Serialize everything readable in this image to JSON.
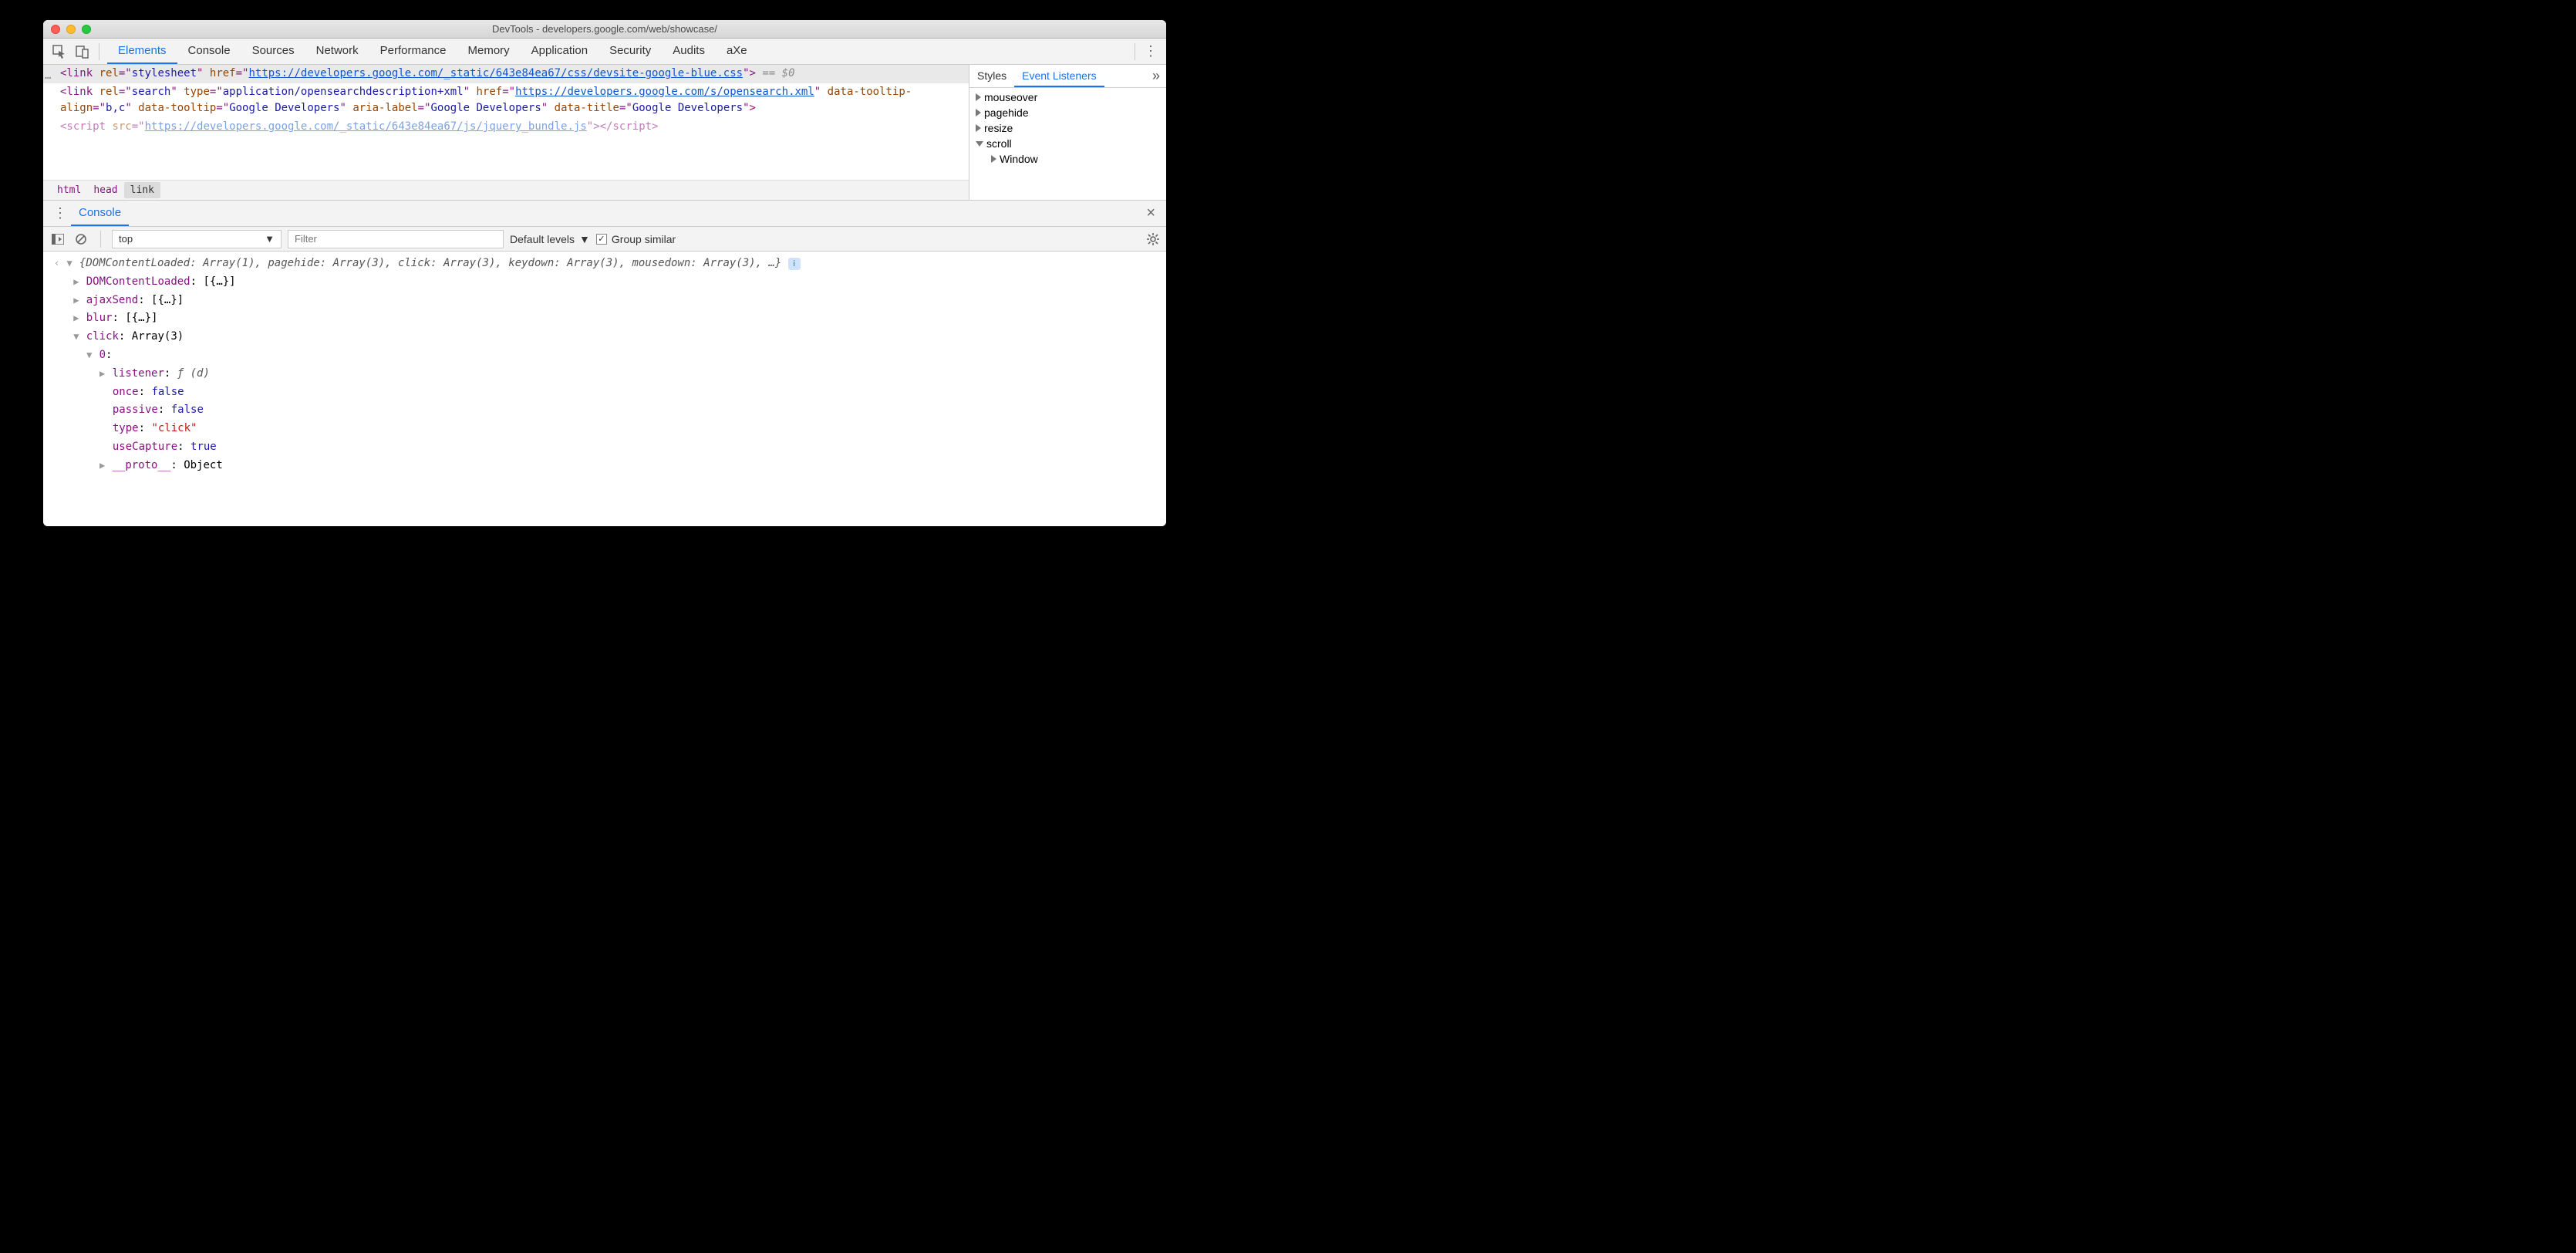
{
  "window": {
    "title": "DevTools - developers.google.com/web/showcase/"
  },
  "mainTabs": [
    "Elements",
    "Console",
    "Sources",
    "Network",
    "Performance",
    "Memory",
    "Application",
    "Security",
    "Audits",
    "aXe"
  ],
  "mainTabActive": "Elements",
  "dom": {
    "line1": {
      "prefix": "<link ",
      "rel_attr": "rel",
      "rel_val": "stylesheet",
      "href_attr": "href",
      "href_val": "https://developers.google.com/_static/643e84ea67/css/devsite-google-blue.css",
      "suffix": ">",
      "eqz": " == $0"
    },
    "line2": {
      "prefix": "<link ",
      "rel_attr": "rel",
      "rel_val": "search",
      "type_attr": "type",
      "type_val": "application/opensearchdescription+xml",
      "href_attr": "href",
      "href_val": "https://developers.google.com/s/opensearch.xml",
      "dta_attr": "data-tooltip-align",
      "dta_val": "b,c",
      "dt_attr": "data-tooltip",
      "dt_val": "Google Developers",
      "al_attr": "aria-label",
      "al_val": "Google Developers",
      "dtt_attr": "data-title",
      "dtt_val": "Google Developers",
      "suffix": ">"
    },
    "line3": {
      "open": "<script ",
      "src_attr": "src",
      "src_val": "https://developers.google.com/_static/643e84ea67/js/jquery_bundle.js",
      "mid": "></",
      "close": "script>"
    }
  },
  "breadcrumbs": {
    "a": "html",
    "b": "head",
    "c": "link"
  },
  "sidebar": {
    "tabs": {
      "styles": "Styles",
      "event": "Event Listeners"
    },
    "events": {
      "mouseover": "mouseover",
      "pagehide": "pagehide",
      "resize": "resize",
      "scroll": "scroll",
      "window": "Window"
    }
  },
  "drawer": {
    "tab": "Console"
  },
  "consoleToolbar": {
    "context": "top",
    "filterPlaceholder": "Filter",
    "levels": "Default levels",
    "groupSimilar": "Group similar"
  },
  "console": {
    "summary_open": "{",
    "summary_k1": "DOMContentLoaded",
    "summary_v1": "Array(1)",
    "summary_k2": "pagehide",
    "summary_v2": "Array(3)",
    "summary_k3": "click",
    "summary_v3": "Array(3)",
    "summary_k4": "keydown",
    "summary_v4": "Array(3)",
    "summary_k5": "mousedown",
    "summary_v5": "Array(3)",
    "summary_close": ", …}",
    "r1_k": "DOMContentLoaded",
    "r1_v": "[{…}]",
    "r2_k": "ajaxSend",
    "r2_v": "[{…}]",
    "r3_k": "blur",
    "r3_v": "[{…}]",
    "r4_k": "click",
    "r4_v": "Array(3)",
    "idx0": "0",
    "listener_k": "listener",
    "listener_v": "ƒ (d)",
    "once_k": "once",
    "once_v": "false",
    "passive_k": "passive",
    "passive_v": "false",
    "type_k": "type",
    "type_v": "\"click\"",
    "useCapture_k": "useCapture",
    "useCapture_v": "true",
    "proto_k": "__proto__",
    "proto_v": "Object"
  }
}
